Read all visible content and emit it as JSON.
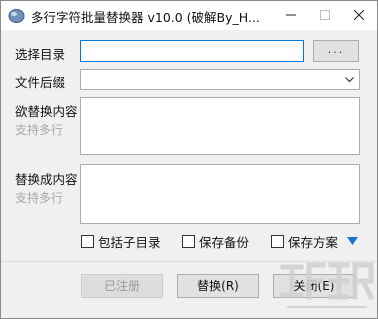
{
  "window": {
    "title": "多行字符批量替换器 v10.0 (破解By_H..."
  },
  "icons": {
    "app": "app-icon",
    "minimize": "minimize-icon",
    "maximize": "maximize-icon",
    "close": "close-icon",
    "dropdown": "chevron-down-icon",
    "more": "triangle-down-icon"
  },
  "form": {
    "directory_label": "选择目录",
    "directory_value": "",
    "browse_label": "...",
    "suffix_label": "文件后缀",
    "suffix_value": "",
    "find_label": "欲替换内容",
    "find_hint": "支持多行",
    "find_value": "",
    "replace_label": "替换成内容",
    "replace_hint": "支持多行",
    "replace_value": ""
  },
  "options": {
    "include_subdirs": "包括子目录",
    "save_backup": "保存备份",
    "save_scheme": "保存方案"
  },
  "buttons": {
    "registered": "已注册",
    "replace": "替换(R)",
    "close": "关闭(E)"
  },
  "colors": {
    "accent": "#0078d7",
    "window_bg": "#f0f0f0"
  }
}
